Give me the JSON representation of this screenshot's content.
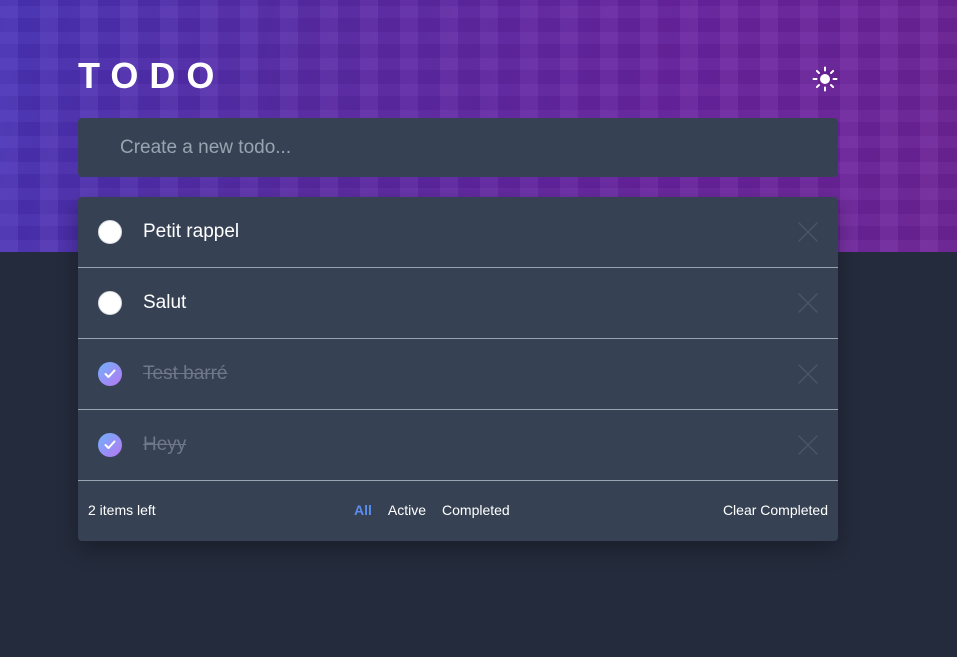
{
  "app": {
    "title": "TODO",
    "theme_toggle_icon": "sun-icon"
  },
  "new_todo": {
    "placeholder": "Create a new todo...",
    "value": ""
  },
  "todos": [
    {
      "text": "Petit rappel",
      "completed": false
    },
    {
      "text": "Salut",
      "completed": false
    },
    {
      "text": "Test barré",
      "completed": true
    },
    {
      "text": "Heyy",
      "completed": true
    }
  ],
  "footer": {
    "items_left": "2 items left",
    "filters": [
      "All",
      "Active",
      "Completed"
    ],
    "active_filter": "All",
    "clear_label": "Clear Completed"
  },
  "colors": {
    "page_background": "#242b3c",
    "card_background": "#364253",
    "accent": "#5a8cf0",
    "check_gradient_start": "#6fb1fb",
    "check_gradient_end": "#b776f2",
    "completed_text": "#6f7888",
    "divider": "#9aa3b0"
  }
}
